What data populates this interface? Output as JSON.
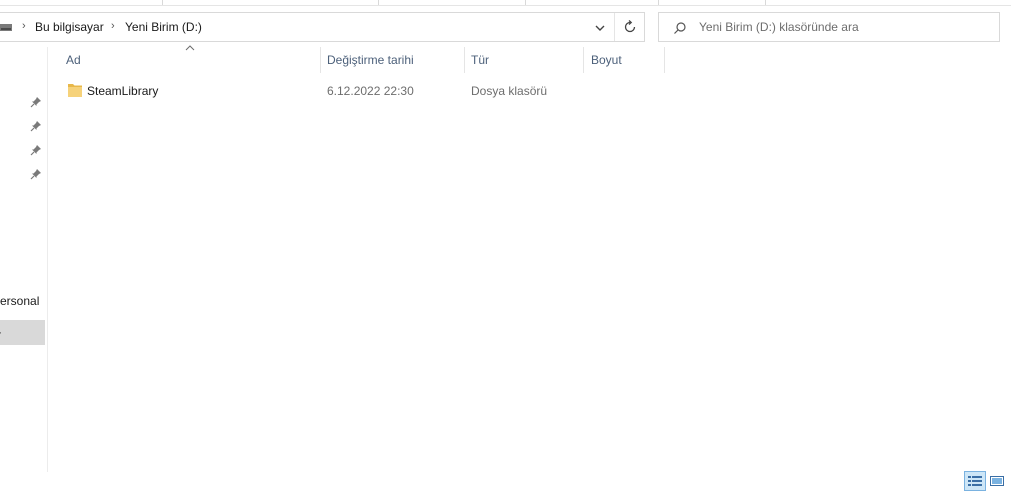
{
  "address_bar": {
    "crumbs": [
      "Bu bilgisayar",
      "Yeni Birim (D:)"
    ]
  },
  "search": {
    "placeholder": "Yeni Birim (D:) klasöründe ara"
  },
  "nav_pane": {
    "pinned_count": 4,
    "items": [
      {
        "label": "ersonal"
      },
      {
        "label": "·"
      }
    ]
  },
  "columns": [
    "Ad",
    "Değiştirme tarihi",
    "Tür",
    "Boyut"
  ],
  "files": [
    {
      "name": "SteamLibrary",
      "modified": "6.12.2022 22:30",
      "type": "Dosya klasörü",
      "size": "",
      "icon": "folder-icon"
    }
  ],
  "colors": {
    "header_text": "#4c607a",
    "selection": "#cde6f7",
    "folder": "#f6d27a"
  }
}
